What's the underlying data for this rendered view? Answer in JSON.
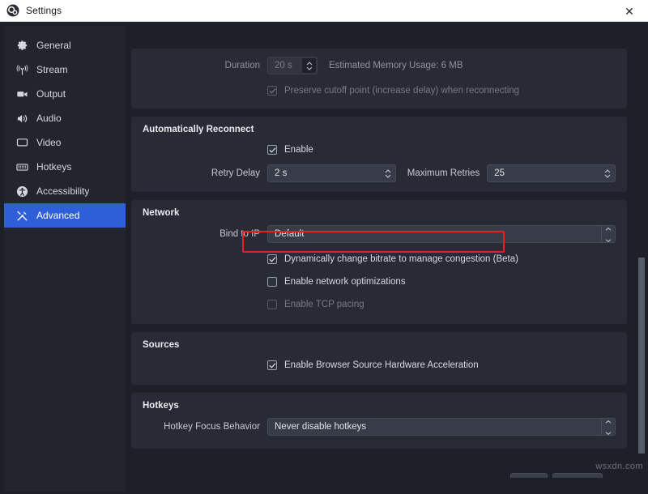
{
  "window": {
    "title": "Settings",
    "app_icon": "obs-logo-icon",
    "close_label": "✕"
  },
  "sidebar": {
    "items": [
      {
        "label": "General",
        "icon": "gear-icon",
        "selected": false
      },
      {
        "label": "Stream",
        "icon": "broadcast-icon",
        "selected": false
      },
      {
        "label": "Output",
        "icon": "camcorder-icon",
        "selected": false
      },
      {
        "label": "Audio",
        "icon": "speaker-icon",
        "selected": false
      },
      {
        "label": "Video",
        "icon": "monitor-icon",
        "selected": false
      },
      {
        "label": "Hotkeys",
        "icon": "keyboard-icon",
        "selected": false
      },
      {
        "label": "Accessibility",
        "icon": "accessibility-icon",
        "selected": false
      },
      {
        "label": "Advanced",
        "icon": "tools-icon",
        "selected": true
      }
    ]
  },
  "replay_buffer": {
    "duration_label": "Duration",
    "duration_value": "20 s",
    "memory_usage": "Estimated Memory Usage: 6 MB",
    "preserve_cutoff_label": "Preserve cutoff point (increase delay) when reconnecting",
    "preserve_cutoff_checked": true,
    "preserve_cutoff_enabled": false
  },
  "auto_reconnect": {
    "title": "Automatically Reconnect",
    "enable_label": "Enable",
    "enable_checked": true,
    "retry_delay_label": "Retry Delay",
    "retry_delay_value": "2 s",
    "max_retries_label": "Maximum Retries",
    "max_retries_value": "25"
  },
  "network": {
    "title": "Network",
    "bind_ip_label": "Bind to IP",
    "bind_ip_value": "Default",
    "dynamic_bitrate_label": "Dynamically change bitrate to manage congestion (Beta)",
    "dynamic_bitrate_checked": true,
    "network_opt_label": "Enable network optimizations",
    "network_opt_checked": false,
    "tcp_pacing_label": "Enable TCP pacing",
    "tcp_pacing_checked": false,
    "tcp_pacing_enabled": false
  },
  "sources": {
    "title": "Sources",
    "browser_accel_label": "Enable Browser Source Hardware Acceleration",
    "browser_accel_checked": true
  },
  "hotkeys": {
    "title": "Hotkeys",
    "focus_behavior_label": "Hotkey Focus Behavior",
    "focus_behavior_value": "Never disable hotkeys"
  },
  "annotation": {
    "highlight_color": "#ee1d24",
    "highlight_target": "dynamic-bitrate-checkbox-row"
  },
  "colors": {
    "accent": "#2f5fd8",
    "page_bg": "#1d2027",
    "group_bg": "#282b35",
    "sidebar_bg": "#22252e",
    "field_bg": "#383c48"
  },
  "watermark": {
    "text": "wsxdn.com"
  }
}
